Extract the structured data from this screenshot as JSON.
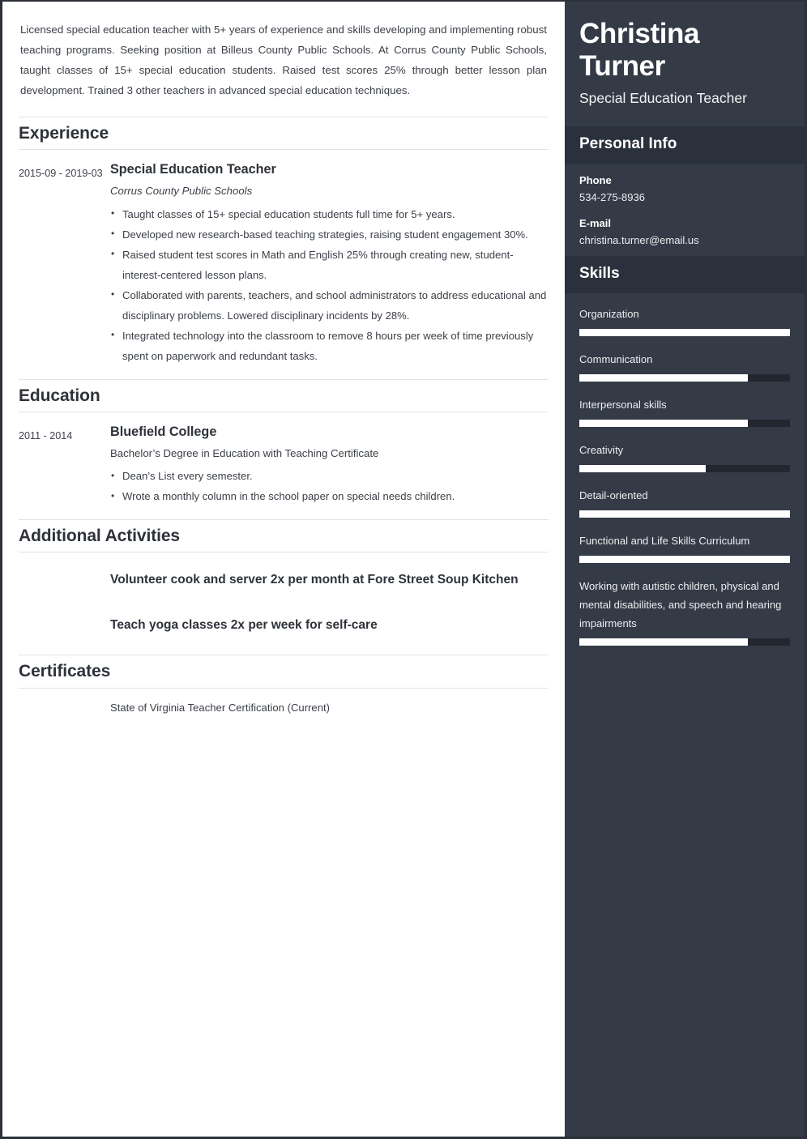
{
  "resume": {
    "summary": "Licensed special education teacher with 5+ years of experience and skills developing and implementing robust teaching programs. Seeking position at Billeus County Public Schools. At Corrus County Public Schools, taught classes of 15+ special education students. Raised test scores 25% through better lesson plan development. Trained 3 other teachers in advanced special education techniques.",
    "sections": {
      "experience": {
        "heading": "Experience",
        "entries": [
          {
            "dates": "2015-09 - 2019-03",
            "title": "Special Education Teacher",
            "subtitle": "Corrus County Public Schools",
            "bullets": [
              "Taught classes of 15+ special education students full time for 5+ years.",
              "Developed new research-based teaching strategies, raising student engagement 30%.",
              "Raised student test scores in Math and English 25% through creating new, student-interest-centered lesson plans.",
              "Collaborated with parents, teachers, and school administrators to address educational and disciplinary problems. Lowered disciplinary incidents by 28%.",
              "Integrated technology into the classroom to remove 8 hours per week of time previously spent on paperwork and redundant tasks."
            ]
          }
        ]
      },
      "education": {
        "heading": "Education",
        "entries": [
          {
            "dates": "2011 - 2014",
            "title": "Bluefield College",
            "subtitle": "Bachelor’s Degree in Education with Teaching Certificate",
            "bullets": [
              "Dean’s List every semester.",
              "Wrote a monthly column in the school paper on special needs children."
            ]
          }
        ]
      },
      "additional_activities": {
        "heading": "Additional Activities",
        "items": [
          "Volunteer cook and server 2x per month at Fore Street Soup Kitchen",
          "Teach yoga classes 2x per week for self-care"
        ]
      },
      "certificates": {
        "heading": "Certificates",
        "items": [
          "State of Virginia Teacher Certification (Current)"
        ]
      }
    }
  },
  "sidebar": {
    "name": "Christina Turner",
    "role": "Special Education Teacher",
    "personal_info": {
      "heading": "Personal Info",
      "fields": [
        {
          "label": "Phone",
          "value": "534-275-8936"
        },
        {
          "label": "E-mail",
          "value": "christina.turner@email.us"
        }
      ]
    },
    "skills": {
      "heading": "Skills",
      "items": [
        {
          "name": "Organization",
          "level": 100
        },
        {
          "name": "Communication",
          "level": 80
        },
        {
          "name": "Interpersonal skills",
          "level": 80
        },
        {
          "name": "Creativity",
          "level": 60
        },
        {
          "name": "Detail-oriented",
          "level": 100
        },
        {
          "name": "Functional and Life Skills Curriculum",
          "level": 100
        },
        {
          "name": "Working with autistic children, physical and mental disabilities, and speech and hearing impairments",
          "level": 80
        }
      ]
    }
  },
  "colors": {
    "sidebar_bg": "#343b47",
    "sidebar_header_bg": "#2b313c",
    "skill_track": "#22262f",
    "skill_fill": "#ffffff",
    "text_dark": "#3c4048",
    "heading_dark": "#2e3239",
    "rule": "#e2e3e5"
  }
}
